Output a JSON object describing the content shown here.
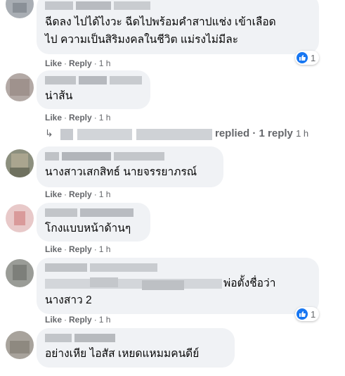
{
  "colors": {
    "bubble": "#f0f2f5",
    "meta": "#65676b",
    "text": "#050505",
    "like_blue": "#1877f2"
  },
  "comments": [
    {
      "text_lines": [
        "ฉีดลง ไปได้ไงวะ ฉีดไปพร้อมคำสาปแช่ง เข้าเลือด",
        "ไป ความเป็นสิริมงคลในชีวิต แม่รงไม่มีละ"
      ],
      "like": "Like",
      "reply": "Reply",
      "time": "1 h",
      "reaction_count": "1"
    },
    {
      "text_lines": [
        "น่าส้น"
      ],
      "like": "Like",
      "reply": "Reply",
      "time": "1 h"
    },
    {
      "text_lines": [
        "นางสาวเสกสิทธ์ นายจรรยาภรณ์"
      ],
      "like": "Like",
      "reply": "Reply",
      "time": "1 h"
    },
    {
      "text_lines": [
        "โกงแบบหน้าด้านๆ"
      ],
      "like": "Like",
      "reply": "Reply",
      "time": "1 h"
    },
    {
      "text_lines": [
        "พ่อตั้งชื่อว่า",
        "นางสาว 2"
      ],
      "like": "Like",
      "reply": "Reply",
      "time": "1 h",
      "reaction_count": "1"
    },
    {
      "text_lines": [
        "อย่างเหีย ไอสัส เหยดแหมมคนดีย์"
      ]
    }
  ],
  "replies_summary": {
    "label": "replied",
    "count_label": "1 reply",
    "time": "1 h",
    "icon": "reply-arrow-icon"
  }
}
